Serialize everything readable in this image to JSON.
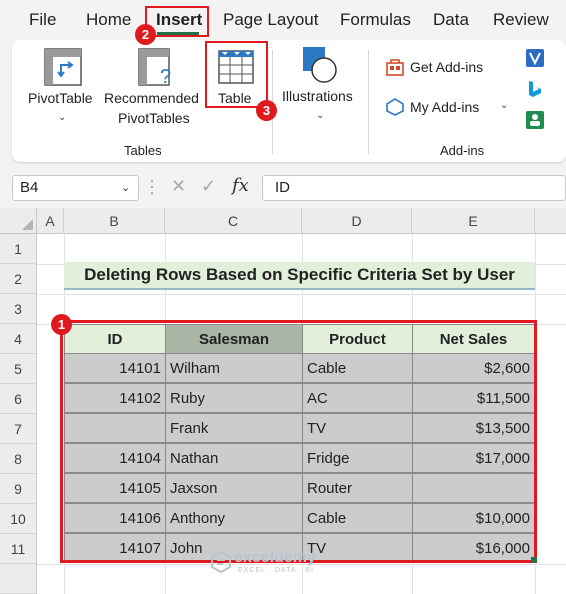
{
  "menu": {
    "tabs": [
      "File",
      "Home",
      "Insert",
      "Page Layout",
      "Formulas",
      "Data",
      "Review"
    ],
    "active": "Insert"
  },
  "ribbon": {
    "pivot_table": "PivotTable",
    "recommended_line1": "Recommended",
    "recommended_line2": "PivotTables",
    "table": "Table",
    "illustrations": "Illustrations",
    "tables_group": "Tables",
    "get_addins": "Get Add-ins",
    "my_addins": "My Add-ins",
    "addins_group": "Add-ins"
  },
  "formula_bar": {
    "name_box": "B4",
    "fx": "fx",
    "formula": "ID"
  },
  "grid": {
    "columns": [
      "A",
      "B",
      "C",
      "D",
      "E"
    ],
    "rows": [
      "1",
      "2",
      "3",
      "4",
      "5",
      "6",
      "7",
      "8",
      "9",
      "10",
      "11"
    ],
    "title": "Deleting Rows Based on Specific Criteria Set by User"
  },
  "table": {
    "headers": [
      "ID",
      "Salesman",
      "Product",
      "Net Sales"
    ],
    "rows": [
      [
        "14101",
        "Wilham",
        "Cable",
        "$2,600"
      ],
      [
        "14102",
        "Ruby",
        "AC",
        "$11,500"
      ],
      [
        "",
        "Frank",
        "TV",
        "$13,500"
      ],
      [
        "14104",
        "Nathan",
        "Fridge",
        "$17,000"
      ],
      [
        "14105",
        "Jaxson",
        "Router",
        ""
      ],
      [
        "14106",
        "Anthony",
        "Cable",
        "$10,000"
      ],
      [
        "14107",
        "John",
        "TV",
        "$16,000"
      ]
    ]
  },
  "badges": [
    "1",
    "2",
    "3"
  ],
  "watermark": {
    "name": "exceldemy",
    "tagline": "EXCEL · DATA · BI"
  },
  "colors": {
    "accent_red": "#e0191e",
    "excel_green": "#217346",
    "header_fill": "#e2efda",
    "salesman_header_fill": "#a9b5a5",
    "cell_fill": "#cccccc"
  },
  "icons": {
    "pivot_table": "pivot-table-icon",
    "recommended": "recommended-pivot-icon",
    "table": "table-grid-icon",
    "illustrations": "illustrations-shapes-icon",
    "get_addins": "store-icon",
    "my_addins": "my-addins-icon"
  }
}
